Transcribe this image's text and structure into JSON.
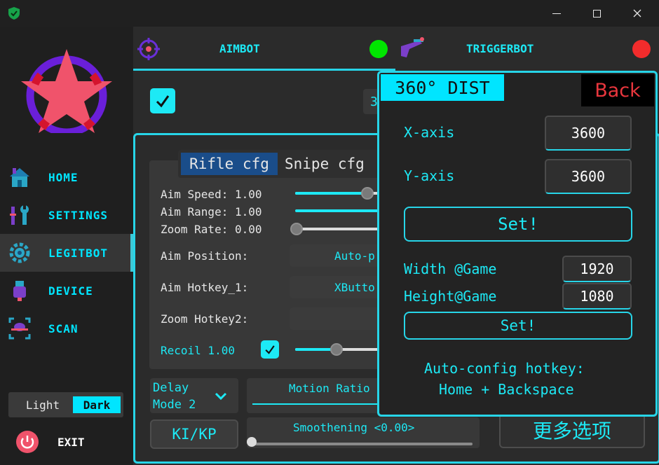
{
  "window": {
    "minimize_icon": "minimize-icon",
    "maximize_icon": "maximize-icon",
    "close_icon": "close-icon"
  },
  "sidebar": {
    "items": [
      {
        "label": "HOME",
        "icon": "home-icon"
      },
      {
        "label": "SETTINGS",
        "icon": "tools-icon"
      },
      {
        "label": "LEGITBOT",
        "icon": "gear-icon",
        "active": true
      },
      {
        "label": "DEVICE",
        "icon": "usb-icon"
      },
      {
        "label": "SCAN",
        "icon": "scan-icon"
      }
    ],
    "theme": {
      "light": "Light",
      "dark": "Dark",
      "selected": "Dark"
    },
    "exit_label": "EXIT"
  },
  "tabs": {
    "aimbot": {
      "label": "AIMBOT",
      "status_color": "#00e600"
    },
    "triggerbot": {
      "label": "TRIGGERBOT",
      "status_color": "#f22c2c"
    }
  },
  "panel": {
    "enabled": true,
    "partial_value": "3",
    "cfg_tabs": [
      "Rifle cfg",
      "Snipe cfg"
    ],
    "selected_cfg": "Rifle cfg",
    "aim_speed_label": "Aim Speed: 1.00",
    "aim_range_label": "Aim Range: 1.00",
    "zoom_rate_label": "Zoom Rate: 0.00",
    "aim_position_label": "Aim Position:",
    "aim_position_value": "Auto-p",
    "aim_hotkey_label": "Aim Hotkey_1:",
    "aim_hotkey_value": "XButto",
    "zoom_hotkey_label": "Zoom Hotkey2:",
    "zoom_hotkey_value": "",
    "recoil_label": "Recoil 1.00",
    "recoil_enabled": true,
    "delay_mode_line1": "Delay",
    "delay_mode_line2": "Mode 2",
    "motion_ratio_label": "Motion Ratio",
    "ki_kp_label": "KI/KP",
    "smoothening_label": "Smoothening <0.00>",
    "more_options_label": "更多选项",
    "sliders": {
      "aim_speed": 0.85,
      "aim_range": 1.0,
      "zoom_rate": 0.0,
      "recoil": 0.5,
      "smoothening": 0.0
    }
  },
  "popup": {
    "title": "360° DIST",
    "back_label": "Back",
    "x_axis_label": "X-axis",
    "x_axis_value": "3600",
    "y_axis_label": "Y-axis",
    "y_axis_value": "3600",
    "set_label_1": "Set!",
    "width_label": "Width @Game",
    "width_value": "1920",
    "height_label": "Height@Game",
    "height_value": "1080",
    "set_label_2": "Set!",
    "hotkey_line1": "Auto-config hotkey:",
    "hotkey_line2": "Home + Backspace"
  },
  "colors": {
    "accent": "#1de9f5",
    "logo_ring": "#6a1fd9",
    "logo_star": "#f0536b",
    "back_text": "#e8363d"
  }
}
